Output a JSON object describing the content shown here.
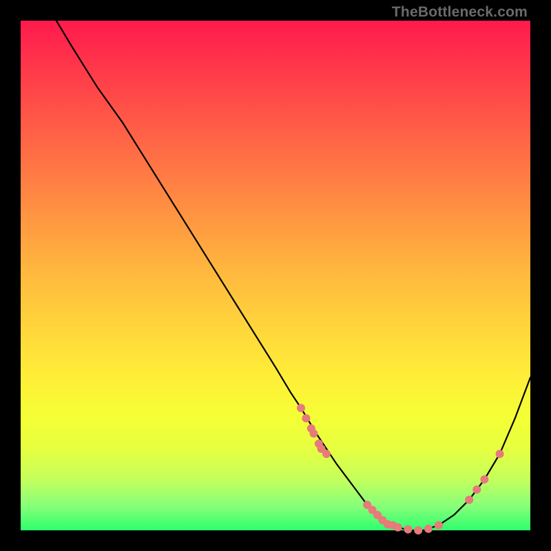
{
  "watermark": "TheBottleneck.com",
  "chart_data": {
    "type": "line",
    "title": "",
    "xlabel": "",
    "ylabel": "",
    "xlim": [
      0,
      100
    ],
    "ylim": [
      0,
      100
    ],
    "grid": false,
    "legend": false,
    "x": [
      7,
      10,
      15,
      20,
      25,
      30,
      35,
      40,
      45,
      50,
      53,
      55,
      58,
      60,
      62,
      65,
      68,
      70,
      73,
      76,
      79,
      82,
      85,
      88,
      91,
      94,
      97,
      100
    ],
    "y": [
      100,
      95,
      87,
      80,
      72,
      64,
      56,
      48,
      40,
      32,
      27,
      24,
      19,
      16,
      13,
      9,
      5,
      3,
      1,
      0,
      0,
      1,
      3,
      6,
      10,
      15,
      22,
      30
    ],
    "series_color": "#000000",
    "markers": {
      "shape": "circle",
      "color": "#e77a7a",
      "radius_px": 6,
      "points": [
        {
          "x": 55,
          "y": 24
        },
        {
          "x": 56,
          "y": 22
        },
        {
          "x": 57,
          "y": 20
        },
        {
          "x": 57.5,
          "y": 19
        },
        {
          "x": 58.5,
          "y": 17
        },
        {
          "x": 59,
          "y": 16
        },
        {
          "x": 60,
          "y": 15
        },
        {
          "x": 68,
          "y": 5
        },
        {
          "x": 69,
          "y": 4
        },
        {
          "x": 70,
          "y": 3
        },
        {
          "x": 71,
          "y": 2
        },
        {
          "x": 72,
          "y": 1.2
        },
        {
          "x": 73,
          "y": 1
        },
        {
          "x": 74,
          "y": 0.6
        },
        {
          "x": 76,
          "y": 0.2
        },
        {
          "x": 78,
          "y": 0
        },
        {
          "x": 80,
          "y": 0.3
        },
        {
          "x": 82,
          "y": 1
        },
        {
          "x": 88,
          "y": 6
        },
        {
          "x": 89.5,
          "y": 8
        },
        {
          "x": 91,
          "y": 10
        },
        {
          "x": 94,
          "y": 15
        }
      ]
    },
    "background_gradient": {
      "top": "#ff1a4d",
      "mid": "#ffd53b",
      "bottom": "#2fff6e"
    }
  }
}
